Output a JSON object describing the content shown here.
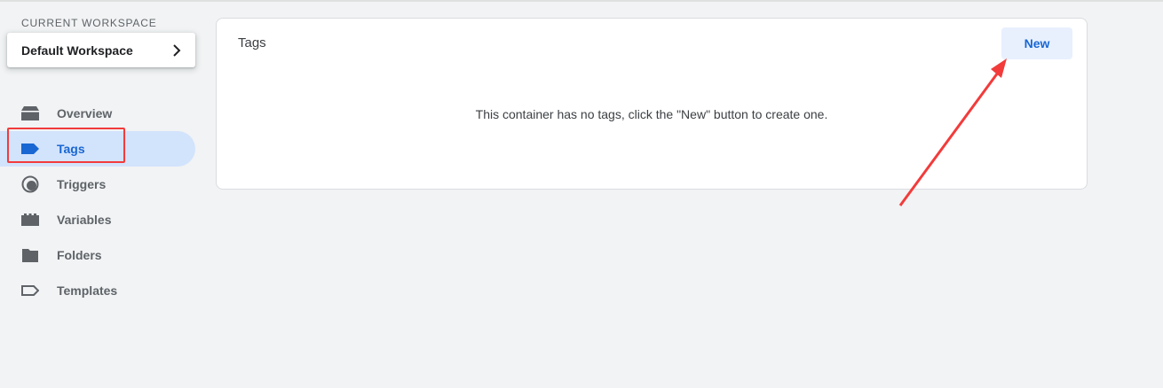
{
  "sidebar": {
    "workspace_label": "CURRENT WORKSPACE",
    "workspace_name": "Default Workspace",
    "items": [
      {
        "label": "Overview",
        "icon": "overview-icon"
      },
      {
        "label": "Tags",
        "icon": "tag-icon",
        "active": true
      },
      {
        "label": "Triggers",
        "icon": "trigger-icon"
      },
      {
        "label": "Variables",
        "icon": "variables-icon"
      },
      {
        "label": "Folders",
        "icon": "folder-icon"
      },
      {
        "label": "Templates",
        "icon": "template-icon"
      }
    ]
  },
  "main": {
    "title": "Tags",
    "new_button": "New",
    "empty_message": "This container has no tags, click the \"New\" button to create one."
  },
  "colors": {
    "accent": "#1967d2",
    "active_bg": "#d2e3fc",
    "annotation": "#f23b3b",
    "icon_gray": "#5f6368"
  }
}
